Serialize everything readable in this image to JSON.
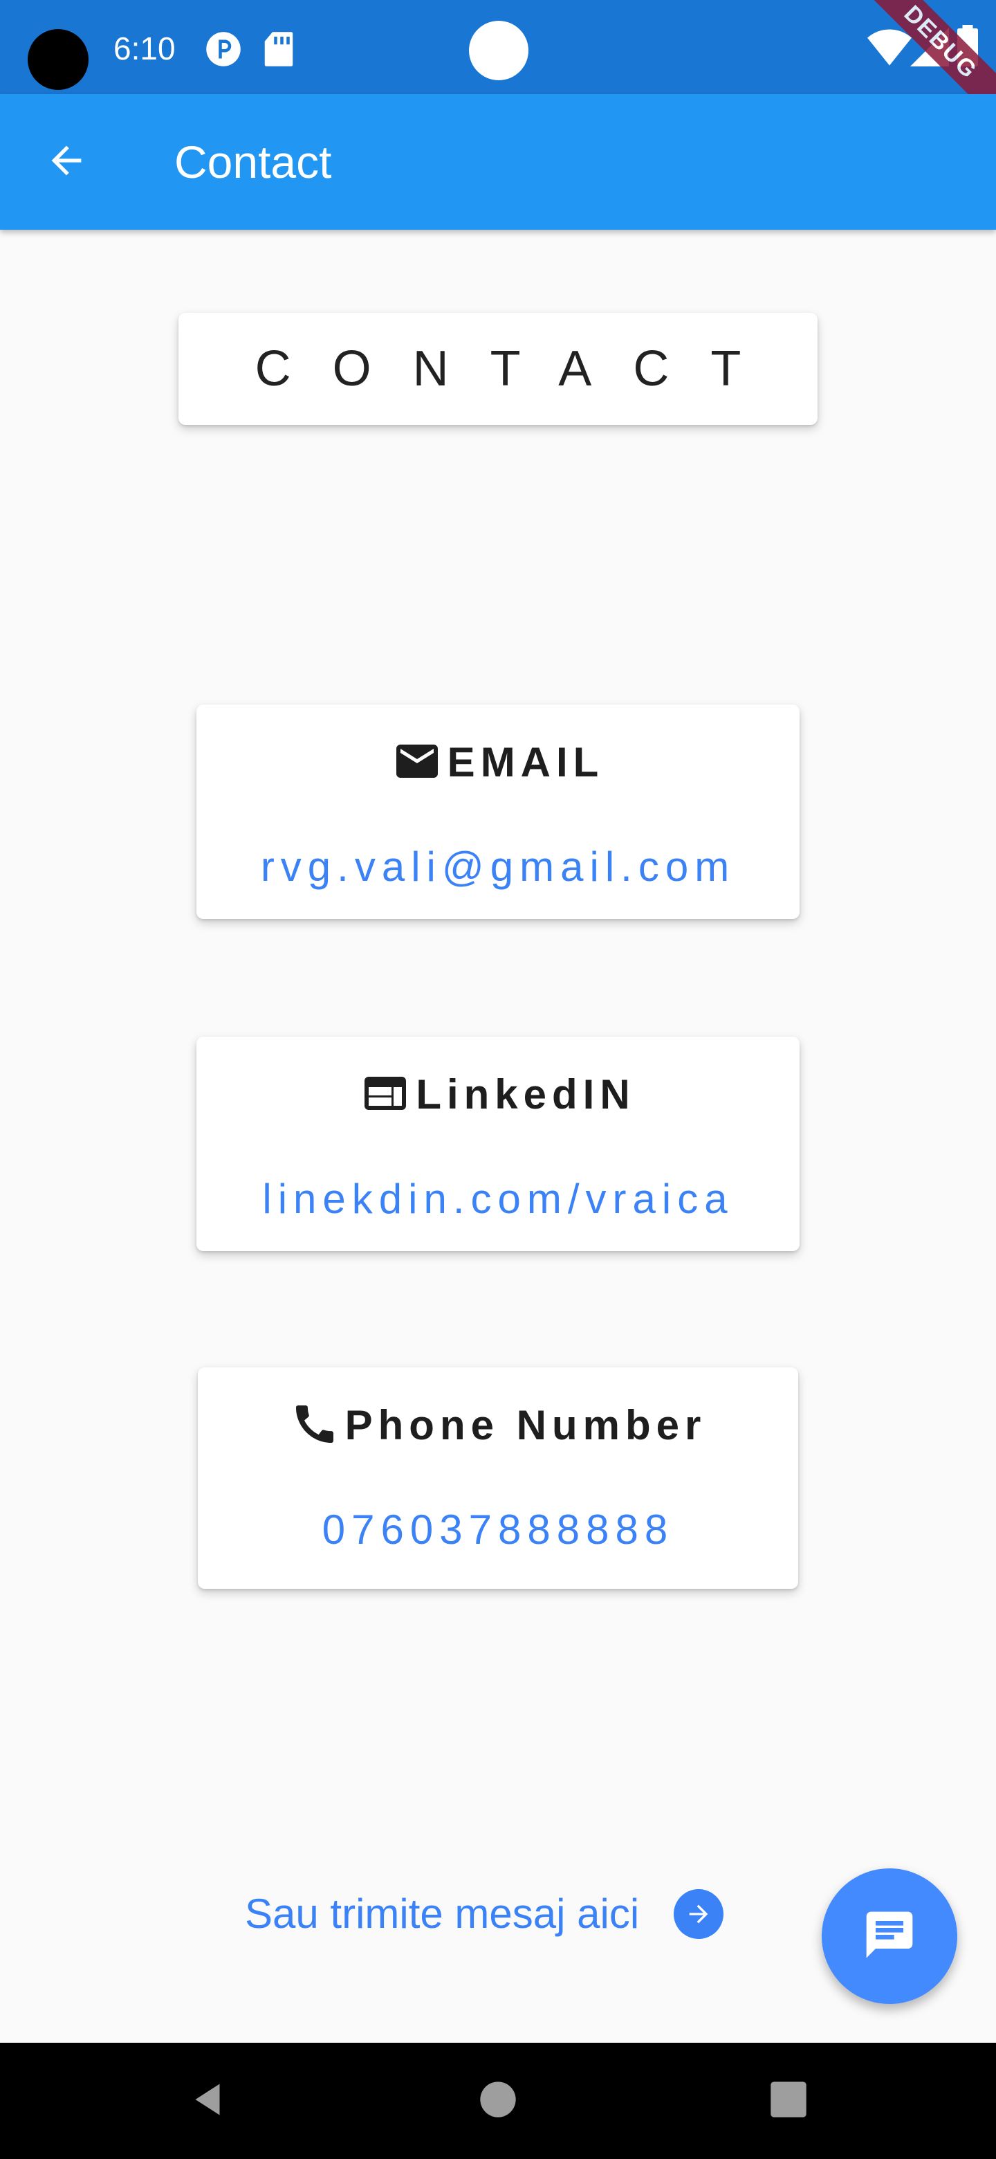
{
  "status_bar": {
    "time": "6:10",
    "debug_banner": "DEBUG",
    "icons": [
      "camera-hole-icon",
      "record-icon",
      "sd-card-icon",
      "wifi-icon",
      "signal-icon",
      "battery-icon"
    ]
  },
  "app_bar": {
    "title": "Contact",
    "back_icon": "arrow-back-icon",
    "color": "#2196f3",
    "status_color": "#1976d2"
  },
  "header_card": {
    "title": "CONTACT"
  },
  "cards": {
    "email": {
      "icon": "mail-icon",
      "label": "EMAIL",
      "value": "rvg.vali@gmail.com"
    },
    "linkedin": {
      "icon": "web-icon",
      "label": "LinkedIN",
      "value": "linekdin.com/vraica"
    },
    "phone": {
      "icon": "phone-icon",
      "label": "Phone Number",
      "value": "076037888888"
    }
  },
  "send_message": {
    "label": "Sau trimite mesaj aici",
    "icon": "arrow-circle-right-icon"
  },
  "fab": {
    "icon": "message-icon",
    "color": "#448aff"
  },
  "nav_bar": {
    "icons": [
      "back-triangle-icon",
      "home-circle-icon",
      "recents-square-icon"
    ]
  },
  "colors": {
    "link": "#3b82f6",
    "background": "#fafafa"
  }
}
